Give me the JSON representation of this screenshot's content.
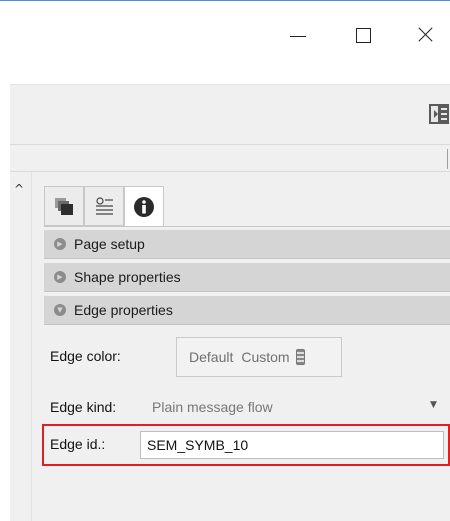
{
  "window": {
    "controls": {
      "minimize_icon": "minimize-icon",
      "maximize_icon": "maximize-icon",
      "close_icon": "close-icon"
    }
  },
  "toolbar": {
    "icon": "panel-toggle-icon"
  },
  "panel": {
    "tabs": [
      {
        "icon": "layers-icon",
        "active": false
      },
      {
        "icon": "properties-list-icon",
        "active": false
      },
      {
        "icon": "info-icon",
        "active": true
      }
    ],
    "sections": [
      {
        "label": "Page setup",
        "expanded": false
      },
      {
        "label": "Shape properties",
        "expanded": false
      },
      {
        "label": "Edge properties",
        "expanded": true
      }
    ],
    "edge": {
      "color_label": "Edge color:",
      "color_default": "Default",
      "color_custom": "Custom",
      "kind_label": "Edge kind:",
      "kind_value": "Plain message flow",
      "id_label": "Edge id.:",
      "id_value": "SEM_SYMB_10"
    }
  },
  "colors": {
    "highlight": "#e02020",
    "section_header": "#d5d5d5",
    "panel_bg": "#f0f0f0"
  }
}
